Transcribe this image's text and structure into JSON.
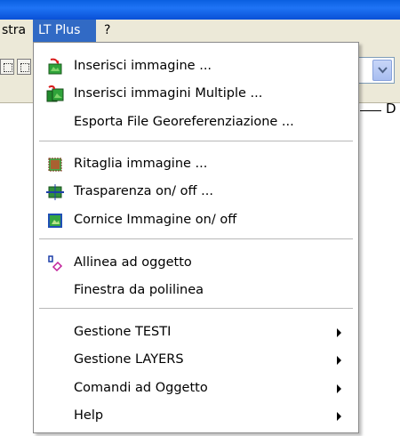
{
  "menubar": {
    "items": [
      {
        "label": "stra"
      },
      {
        "label": "LT Plus"
      },
      {
        "label": "?"
      }
    ]
  },
  "background": {
    "dim_label": "D"
  },
  "menu": {
    "items": [
      {
        "label": "Inserisci immagine ...",
        "icon": "insert-image-icon"
      },
      {
        "label": "Inserisci immagini Multiple ...",
        "icon": "insert-multiple-images-icon"
      },
      {
        "label": "Esporta File Georeferenziazione ..."
      },
      {
        "label": "Ritaglia immagine ...",
        "icon": "crop-image-icon"
      },
      {
        "label": "Trasparenza on/ off ...",
        "icon": "transparency-icon"
      },
      {
        "label": "Cornice Immagine on/ off",
        "icon": "image-frame-icon"
      },
      {
        "label": "Allinea ad oggetto",
        "icon": "align-object-icon"
      },
      {
        "label": "Finestra da polilinea"
      },
      {
        "label": "Gestione TESTI",
        "submenu": true
      },
      {
        "label": "Gestione LAYERS",
        "submenu": true
      },
      {
        "label": "Comandi ad Oggetto",
        "submenu": true
      },
      {
        "label": "Help",
        "submenu": true
      }
    ]
  },
  "colors": {
    "menu_highlight": "#316ac5",
    "menubar_bg": "#ece9d8",
    "titlebar": "#0a5fe0"
  }
}
